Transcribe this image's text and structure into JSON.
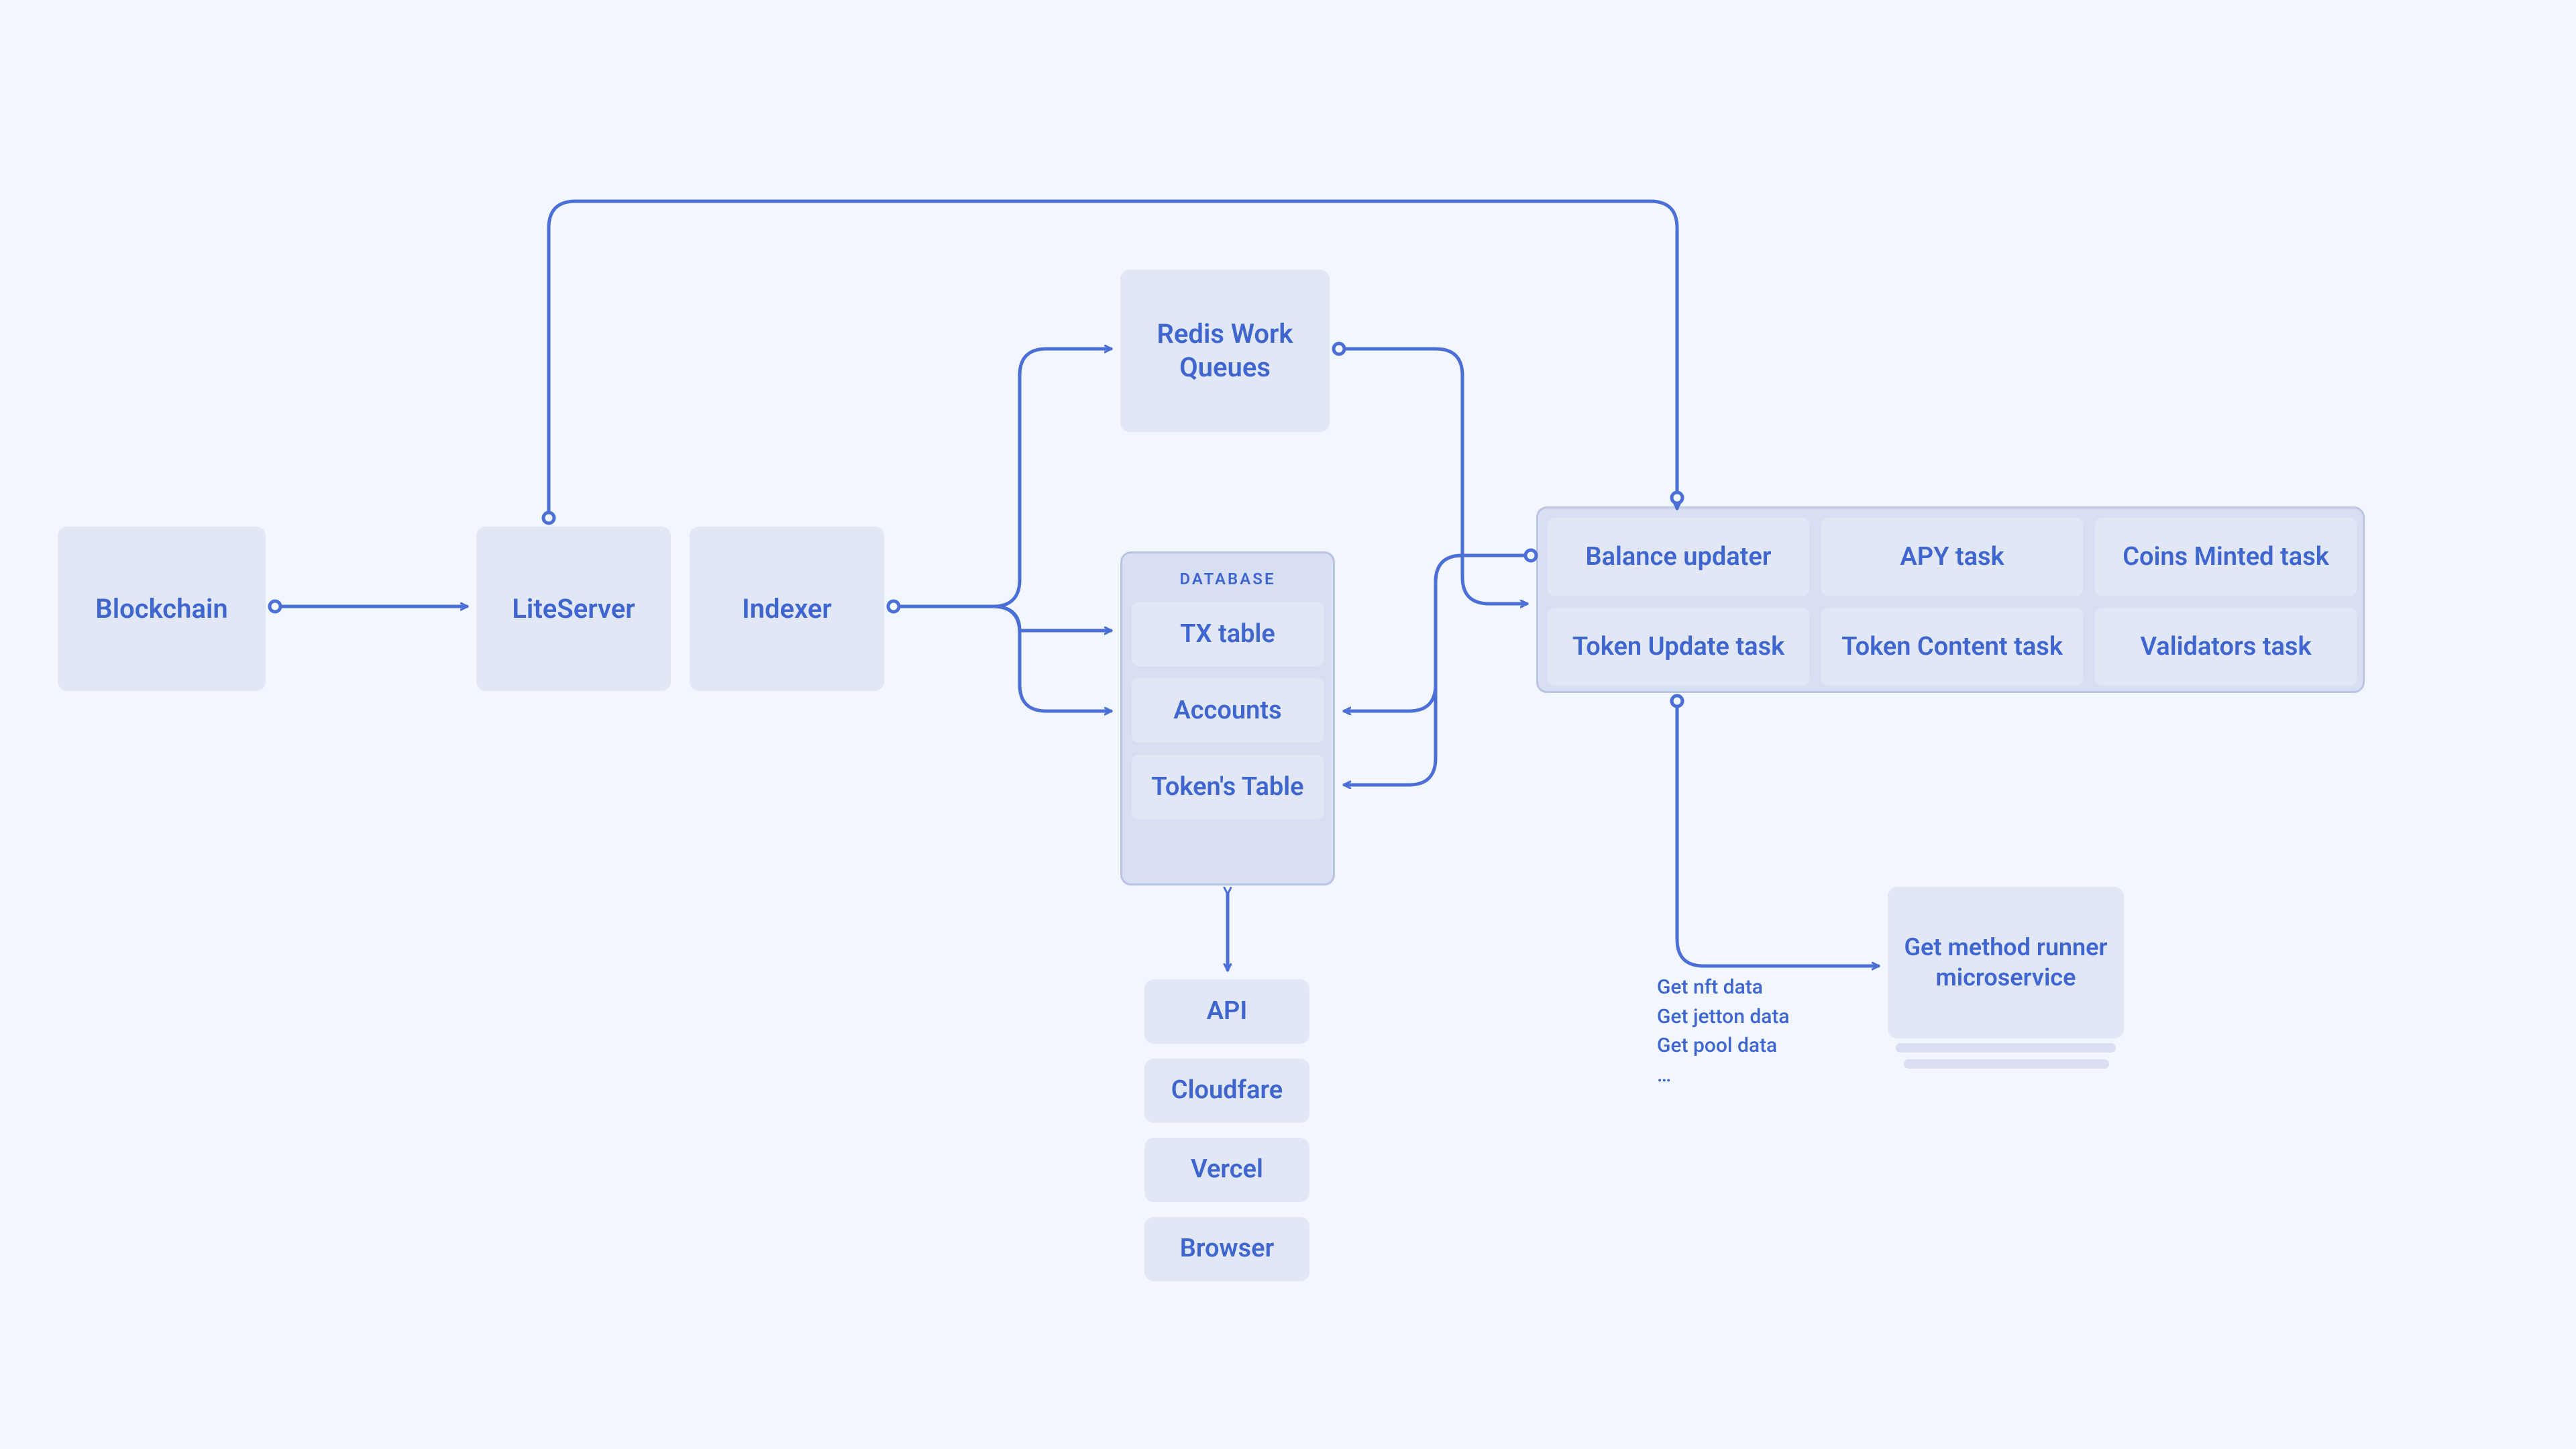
{
  "nodes": {
    "blockchain": "Blockchain",
    "liteserver": "LiteServer",
    "indexer": "Indexer",
    "redis": "Redis Work Queues"
  },
  "database": {
    "label": "DATABASE",
    "rows": [
      "TX table",
      "Accounts",
      "Token's Table"
    ]
  },
  "tasks": [
    "Balance updater",
    "APY task",
    "Coins Minted task",
    "Token Update task",
    "Token Content task",
    "Validators task"
  ],
  "stack": [
    "API",
    "Cloudfare",
    "Vercel",
    "Browser"
  ],
  "microservice": "Get method runner microservice",
  "note": "Get nft data\nGet jetton data\nGet pool data\n…"
}
